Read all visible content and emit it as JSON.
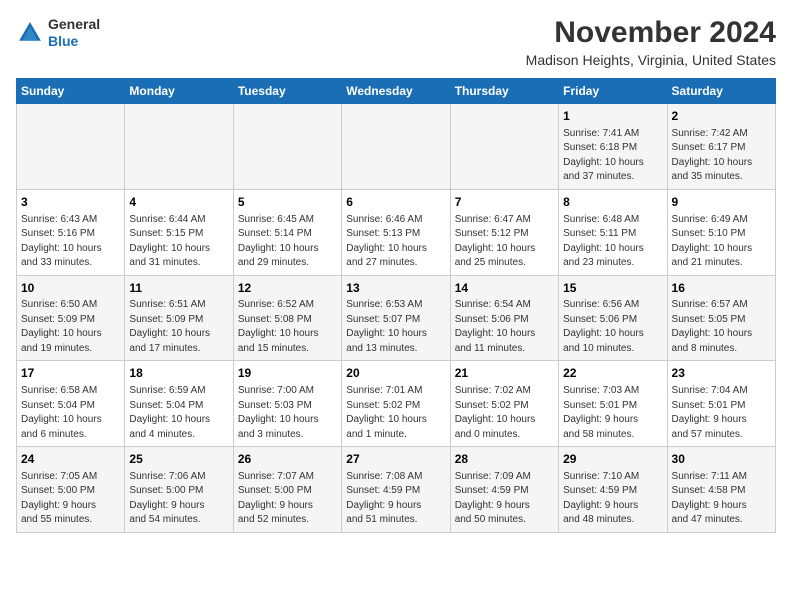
{
  "header": {
    "logo_line1": "General",
    "logo_line2": "Blue",
    "month_year": "November 2024",
    "location": "Madison Heights, Virginia, United States"
  },
  "weekdays": [
    "Sunday",
    "Monday",
    "Tuesday",
    "Wednesday",
    "Thursday",
    "Friday",
    "Saturday"
  ],
  "weeks": [
    [
      {
        "day": "",
        "info": ""
      },
      {
        "day": "",
        "info": ""
      },
      {
        "day": "",
        "info": ""
      },
      {
        "day": "",
        "info": ""
      },
      {
        "day": "",
        "info": ""
      },
      {
        "day": "1",
        "info": "Sunrise: 7:41 AM\nSunset: 6:18 PM\nDaylight: 10 hours\nand 37 minutes."
      },
      {
        "day": "2",
        "info": "Sunrise: 7:42 AM\nSunset: 6:17 PM\nDaylight: 10 hours\nand 35 minutes."
      }
    ],
    [
      {
        "day": "3",
        "info": "Sunrise: 6:43 AM\nSunset: 5:16 PM\nDaylight: 10 hours\nand 33 minutes."
      },
      {
        "day": "4",
        "info": "Sunrise: 6:44 AM\nSunset: 5:15 PM\nDaylight: 10 hours\nand 31 minutes."
      },
      {
        "day": "5",
        "info": "Sunrise: 6:45 AM\nSunset: 5:14 PM\nDaylight: 10 hours\nand 29 minutes."
      },
      {
        "day": "6",
        "info": "Sunrise: 6:46 AM\nSunset: 5:13 PM\nDaylight: 10 hours\nand 27 minutes."
      },
      {
        "day": "7",
        "info": "Sunrise: 6:47 AM\nSunset: 5:12 PM\nDaylight: 10 hours\nand 25 minutes."
      },
      {
        "day": "8",
        "info": "Sunrise: 6:48 AM\nSunset: 5:11 PM\nDaylight: 10 hours\nand 23 minutes."
      },
      {
        "day": "9",
        "info": "Sunrise: 6:49 AM\nSunset: 5:10 PM\nDaylight: 10 hours\nand 21 minutes."
      }
    ],
    [
      {
        "day": "10",
        "info": "Sunrise: 6:50 AM\nSunset: 5:09 PM\nDaylight: 10 hours\nand 19 minutes."
      },
      {
        "day": "11",
        "info": "Sunrise: 6:51 AM\nSunset: 5:09 PM\nDaylight: 10 hours\nand 17 minutes."
      },
      {
        "day": "12",
        "info": "Sunrise: 6:52 AM\nSunset: 5:08 PM\nDaylight: 10 hours\nand 15 minutes."
      },
      {
        "day": "13",
        "info": "Sunrise: 6:53 AM\nSunset: 5:07 PM\nDaylight: 10 hours\nand 13 minutes."
      },
      {
        "day": "14",
        "info": "Sunrise: 6:54 AM\nSunset: 5:06 PM\nDaylight: 10 hours\nand 11 minutes."
      },
      {
        "day": "15",
        "info": "Sunrise: 6:56 AM\nSunset: 5:06 PM\nDaylight: 10 hours\nand 10 minutes."
      },
      {
        "day": "16",
        "info": "Sunrise: 6:57 AM\nSunset: 5:05 PM\nDaylight: 10 hours\nand 8 minutes."
      }
    ],
    [
      {
        "day": "17",
        "info": "Sunrise: 6:58 AM\nSunset: 5:04 PM\nDaylight: 10 hours\nand 6 minutes."
      },
      {
        "day": "18",
        "info": "Sunrise: 6:59 AM\nSunset: 5:04 PM\nDaylight: 10 hours\nand 4 minutes."
      },
      {
        "day": "19",
        "info": "Sunrise: 7:00 AM\nSunset: 5:03 PM\nDaylight: 10 hours\nand 3 minutes."
      },
      {
        "day": "20",
        "info": "Sunrise: 7:01 AM\nSunset: 5:02 PM\nDaylight: 10 hours\nand 1 minute."
      },
      {
        "day": "21",
        "info": "Sunrise: 7:02 AM\nSunset: 5:02 PM\nDaylight: 10 hours\nand 0 minutes."
      },
      {
        "day": "22",
        "info": "Sunrise: 7:03 AM\nSunset: 5:01 PM\nDaylight: 9 hours\nand 58 minutes."
      },
      {
        "day": "23",
        "info": "Sunrise: 7:04 AM\nSunset: 5:01 PM\nDaylight: 9 hours\nand 57 minutes."
      }
    ],
    [
      {
        "day": "24",
        "info": "Sunrise: 7:05 AM\nSunset: 5:00 PM\nDaylight: 9 hours\nand 55 minutes."
      },
      {
        "day": "25",
        "info": "Sunrise: 7:06 AM\nSunset: 5:00 PM\nDaylight: 9 hours\nand 54 minutes."
      },
      {
        "day": "26",
        "info": "Sunrise: 7:07 AM\nSunset: 5:00 PM\nDaylight: 9 hours\nand 52 minutes."
      },
      {
        "day": "27",
        "info": "Sunrise: 7:08 AM\nSunset: 4:59 PM\nDaylight: 9 hours\nand 51 minutes."
      },
      {
        "day": "28",
        "info": "Sunrise: 7:09 AM\nSunset: 4:59 PM\nDaylight: 9 hours\nand 50 minutes."
      },
      {
        "day": "29",
        "info": "Sunrise: 7:10 AM\nSunset: 4:59 PM\nDaylight: 9 hours\nand 48 minutes."
      },
      {
        "day": "30",
        "info": "Sunrise: 7:11 AM\nSunset: 4:58 PM\nDaylight: 9 hours\nand 47 minutes."
      }
    ]
  ]
}
